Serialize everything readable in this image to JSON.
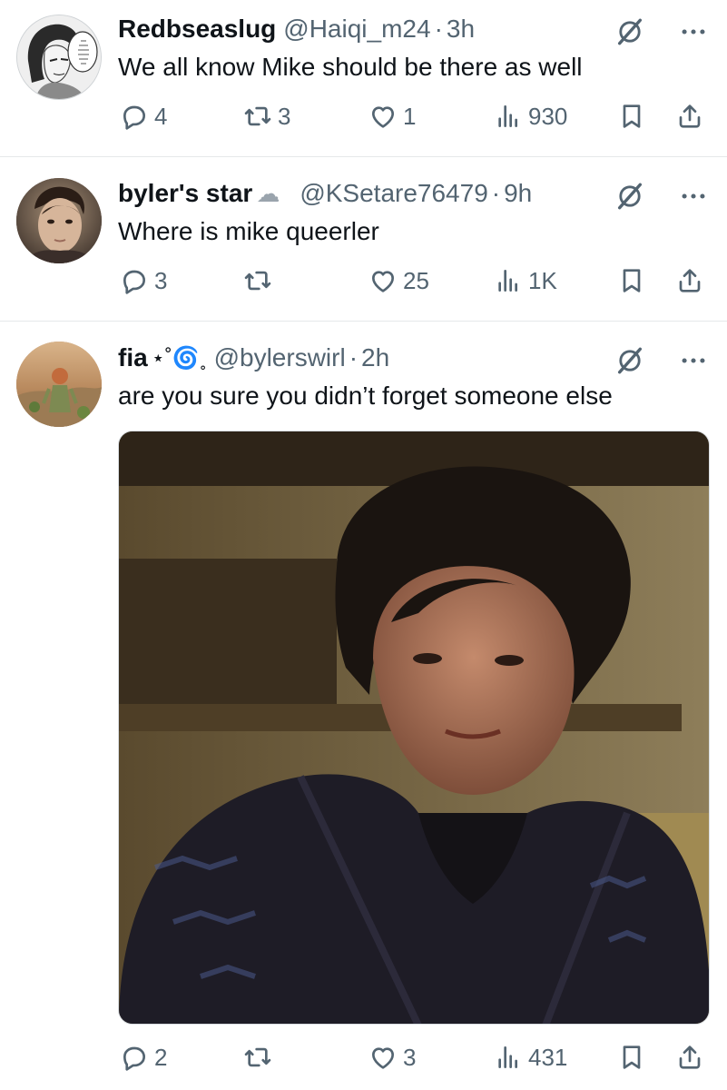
{
  "tweets": [
    {
      "display_name": "Redbseaslug",
      "name_extra": "",
      "handle": "@Haiqi_m24",
      "separator": "·",
      "time": "3h",
      "text": "We all know Mike should be there as well",
      "reply_count": "4",
      "retweet_count": "3",
      "like_count": "1",
      "view_count": "930",
      "avatar_icon": "manga-avatar",
      "avatar_text": "DO US ALL A FAVOR AND SHUT THE FUCK UP"
    },
    {
      "display_name": "byler's star",
      "name_extra": "☁",
      "handle": "@KSetare76479",
      "separator": "·",
      "time": "9h",
      "text": "Where is mike queerler",
      "reply_count": "3",
      "retweet_count": "",
      "like_count": "25",
      "view_count": "1K",
      "avatar_icon": "photo-avatar"
    },
    {
      "display_name": "fia",
      "name_extra": "⋆˚🌀˳",
      "handle": "@bylerswirl",
      "separator": "·",
      "time": "2h",
      "text": "are you sure you didn’t forget someone else",
      "reply_count": "2",
      "retweet_count": "",
      "like_count": "3",
      "view_count": "431",
      "avatar_icon": "photo-avatar",
      "media": "photo-media"
    }
  ],
  "colors": {
    "text_primary": "#0f1419",
    "text_secondary": "#536471",
    "divider": "#e6e8ea"
  }
}
